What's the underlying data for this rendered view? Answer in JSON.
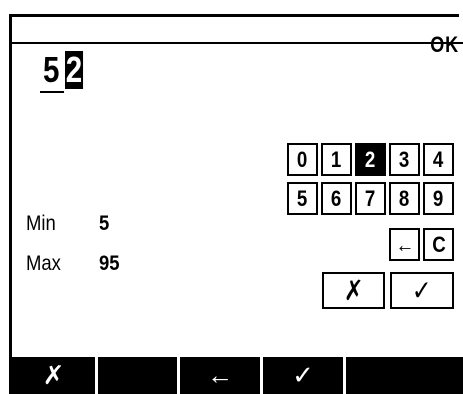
{
  "header": {
    "ok_label": "OK"
  },
  "entry": {
    "digit_1": "5",
    "digit_2": "2"
  },
  "limits": {
    "min_label": "Min",
    "min_value": "5",
    "max_label": "Max",
    "max_value": "95"
  },
  "keypad": {
    "row1": [
      "0",
      "1",
      "2",
      "3",
      "4"
    ],
    "row2": [
      "5",
      "6",
      "7",
      "8",
      "9"
    ],
    "selected": "2",
    "backspace": "←",
    "clear": "C",
    "cancel": "✗",
    "confirm": "✓"
  },
  "softkeys": {
    "cancel": "✗",
    "blank_1": "",
    "back": "←",
    "confirm": "✓",
    "blank_2": ""
  }
}
